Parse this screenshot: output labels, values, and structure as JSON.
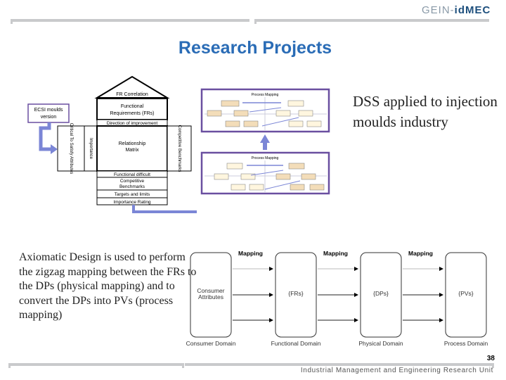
{
  "header": {
    "logo_prefix": "GEIN-",
    "logo_brand": "idMEC"
  },
  "title": "Research Projects",
  "dss_text": "DSS applied to injection moulds industry",
  "axiomatic_text": "Axiomatic Design is used to perform the zigzag mapping between the FRs to the DPs (physical mapping) and to convert the DPs into PVs (process mapping)",
  "qfd": {
    "ecsi": [
      "ECSI moulds",
      "version"
    ],
    "roof": "FR Correlation",
    "frs": [
      "Functional",
      "Requirements (FRs)"
    ],
    "direction": "Direction of improvement",
    "left1": "Critical To Satisfy Attributes",
    "left2": "Importance",
    "matrix": [
      "Relationship",
      "Matrix"
    ],
    "right": "Competitive Benchmarks",
    "rows": [
      "Functional difficult",
      "Competitive",
      "Benchmarks",
      "Targets and limits",
      "Importance Rating"
    ]
  },
  "process_mapping": {
    "title": "Process Mapping"
  },
  "ad_diagram": {
    "mapping": "Mapping",
    "domains": [
      {
        "inner": [
          "Consumer",
          "Attributes"
        ],
        "label": "Consumer Domain"
      },
      {
        "inner": [
          "{FRs}"
        ],
        "label": "Functional Domain"
      },
      {
        "inner": [
          "{DPs}"
        ],
        "label": "Physical Domain"
      },
      {
        "inner": [
          "{PVs}"
        ],
        "label": "Process Domain"
      }
    ]
  },
  "page_number": "38",
  "footer": "Industrial Management and Engineering Research Unit",
  "colors": {
    "title": "#2a6cb6",
    "arrow": "#7b86d6",
    "frame": "#6a4fa0"
  }
}
